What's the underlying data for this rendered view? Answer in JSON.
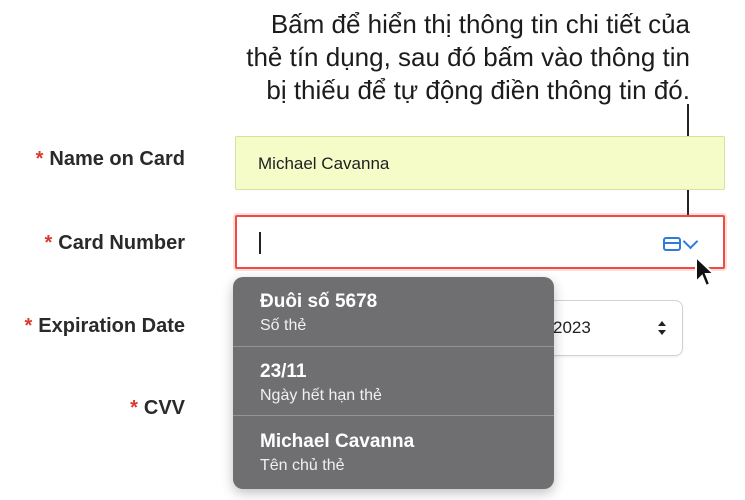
{
  "callout": {
    "text_line1": "Bấm để hiển thị thông tin chi tiết của",
    "text_line2": "thẻ tín dụng, sau đó bấm vào thông tin",
    "text_line3": "bị thiếu để tự động điền thông tin đó."
  },
  "form": {
    "required_mark": "*",
    "name_on_card": {
      "label": "Name on Card",
      "value": "Michael Cavanna"
    },
    "card_number": {
      "label": "Card Number",
      "value": ""
    },
    "expiration_date": {
      "label": "Expiration Date",
      "year_value": "2023"
    },
    "cvv": {
      "label": "CVV"
    }
  },
  "dropdown": {
    "items": [
      {
        "title": "Đuôi số 5678",
        "subtitle": "Số thẻ"
      },
      {
        "title": "23/11",
        "subtitle": "Ngày hết hạn thẻ"
      },
      {
        "title": "Michael Cavanna",
        "subtitle": "Tên chủ thẻ"
      }
    ]
  },
  "icons": {
    "autofill_card": "credit-card-icon",
    "autofill_chevron": "chevron-down-icon",
    "stepper": "up-down-arrows-icon",
    "pointer": "mouse-pointer-icon"
  },
  "colors": {
    "required": "#d83a2e",
    "accent": "#2f7bdc",
    "error_border": "#f14a44",
    "autofilled_bg": "#f5fcc8",
    "menu_bg": "#6f6f72"
  }
}
